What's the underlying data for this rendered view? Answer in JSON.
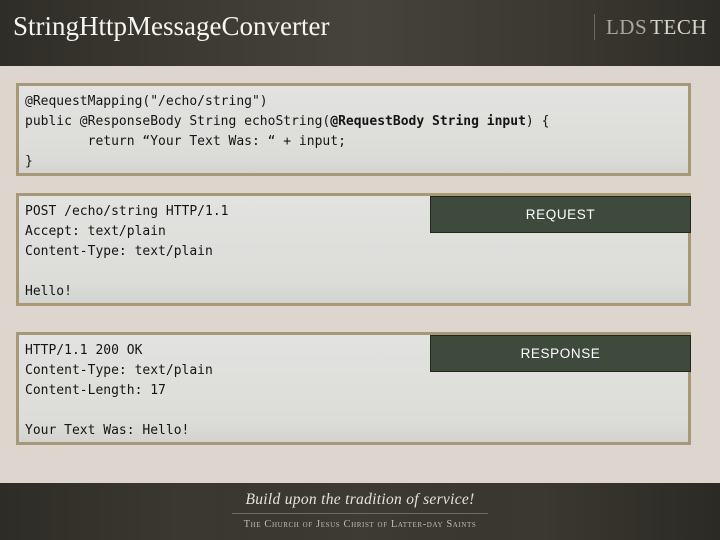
{
  "header": {
    "title": "StringHttpMessageConverter",
    "logo": {
      "primary": "LDS",
      "secondary": "TECH"
    }
  },
  "panels": {
    "code_sample": {
      "lines": [
        "@RequestMapping(\"/echo/string\")",
        "public @ResponseBody String echoString(",
        "@RequestBody String input",
        ") {",
        "        return “Your Text Was: “ + input;",
        "}"
      ],
      "line1": "@RequestMapping(\"/echo/string\")",
      "line2_prefix": "public @ResponseBody String echoString(",
      "line2_bold": "@RequestBody String input",
      "line2_suffix": ") {",
      "line3": "        return “Your Text Was: “ + input;",
      "line4": "}"
    },
    "request": {
      "badge_label": "REQUEST",
      "body": "POST /echo/string HTTP/1.1\nAccept: text/plain\nContent-Type: text/plain\n\nHello!"
    },
    "response": {
      "badge_label": "RESPONSE",
      "body": "HTTP/1.1 200 OK\nContent-Type: text/plain\nContent-Length: 17\n\nYour Text Was: Hello!"
    }
  },
  "footer": {
    "tagline": "Build upon the tradition of service!",
    "church": "The Church of Jesus Christ of Latter-day Saints"
  },
  "colors": {
    "header_bg": "#33312b",
    "page_bg": "#dcd6cf",
    "panel_border": "#a79877",
    "panel_bg": "#dfdfdc",
    "badge_bg": "#3e4a3c",
    "code_text": "#151515"
  }
}
